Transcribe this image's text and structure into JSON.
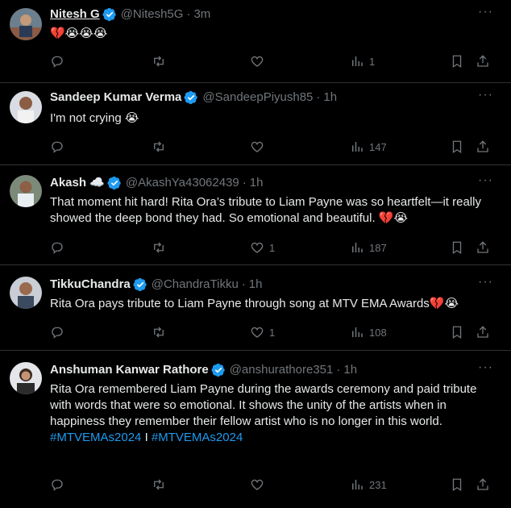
{
  "tweets": [
    {
      "name": "Nitesh G",
      "handle": "@Nitesh5G",
      "time": "3m",
      "text": "💔😭😭😭",
      "counts": {
        "reply": "",
        "retweet": "",
        "like": "",
        "views": "1"
      }
    },
    {
      "name": "Sandeep Kumar Verma",
      "handle": "@SandeepPiyush85",
      "time": "1h",
      "text": "I'm not crying 😭",
      "counts": {
        "reply": "",
        "retweet": "",
        "like": "",
        "views": "147"
      }
    },
    {
      "name": "Akash ☁️",
      "handle": "@AkashYa43062439",
      "time": "1h",
      "text": "That moment hit hard! Rita Ora’s tribute to Liam Payne was so heartfelt—it really showed the deep bond they had. So emotional and beautiful. 💔😭",
      "counts": {
        "reply": "",
        "retweet": "",
        "like": "1",
        "views": "187"
      }
    },
    {
      "name": "TikkuChandra",
      "handle": "@ChandraTikku",
      "time": "1h",
      "text": "Rita Ora pays tribute to Liam Payne through song at MTV EMA Awards💔😭",
      "counts": {
        "reply": "",
        "retweet": "",
        "like": "1",
        "views": "108"
      }
    },
    {
      "name": "Anshuman Kanwar Rathore",
      "handle": "@anshurathore351",
      "time": "1h",
      "text": "Rita Ora remembered Liam Payne during the awards ceremony and paid tribute with words that were so emotional. It shows the unity of the artists when in happiness they remember their fellow artist who is no longer in this world.",
      "hashtag1": "#MTVEMAs2024",
      "separator": "I",
      "hashtag2": "#MTVEMAs2024",
      "counts": {
        "reply": "",
        "retweet": "",
        "like": "",
        "views": "231"
      }
    }
  ],
  "ui": {
    "more_label": "···",
    "dot": "·",
    "colors": {
      "background": "#000000",
      "text": "#e7e9ea",
      "muted": "#71767b",
      "link": "#1d9bf0",
      "verified": "#1d9bf0",
      "divider": "#2f3336"
    },
    "icons": [
      "reply-icon",
      "retweet-icon",
      "like-icon",
      "views-icon",
      "bookmark-icon",
      "share-icon",
      "verified-badge-icon",
      "more-icon"
    ]
  }
}
